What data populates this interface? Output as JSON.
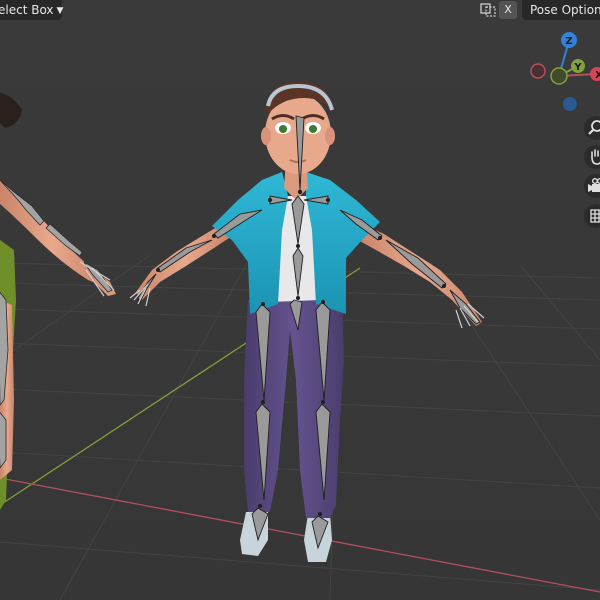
{
  "header": {
    "select_mode": "elect Box",
    "xray_toggle": "X",
    "pose_options": "Pose Options"
  },
  "gizmo": {
    "z_label": "Z",
    "y_label": "Y",
    "x_label": "X"
  },
  "toolbar": {
    "icons": [
      "zoom-icon",
      "pan-hand-icon",
      "camera-icon",
      "grid-view-icon"
    ]
  },
  "colors": {
    "background": "#393939",
    "grid": "#434343",
    "x_axis": "#b3505c",
    "y_axis": "#84a23a",
    "z_axis": "#2f83d8",
    "shirt": "#23a9c8",
    "pants": "#5b4b82",
    "bones": "#9a9a9a"
  }
}
